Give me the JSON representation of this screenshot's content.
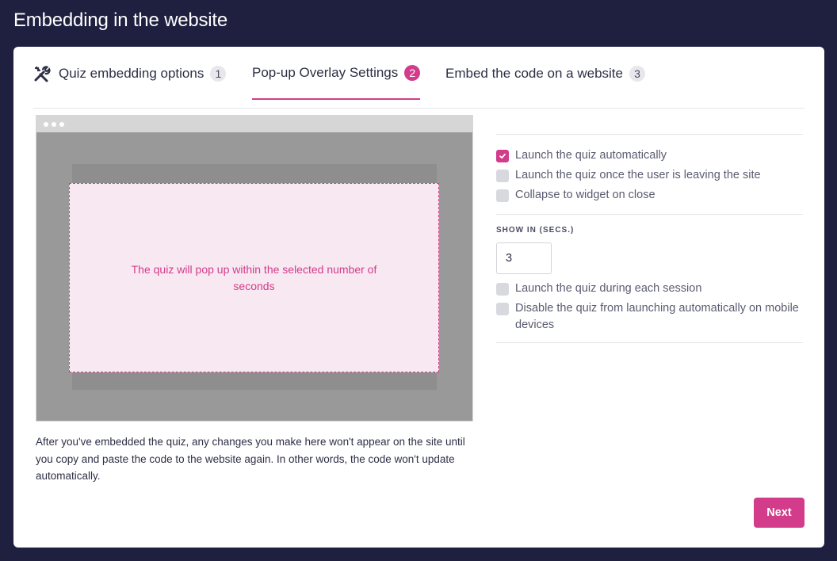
{
  "page": {
    "title": "Embedding in the website"
  },
  "tabs": [
    {
      "label": "Quiz embedding options",
      "number": "1",
      "icon": "tools-icon"
    },
    {
      "label": "Pop-up Overlay Settings",
      "number": "2",
      "active": true
    },
    {
      "label": "Embed the code on a website",
      "number": "3"
    }
  ],
  "preview": {
    "popup_text": "The quiz will pop up within the selected number of seconds"
  },
  "note": "After you've embedded the quiz, any changes you make here won't appear on the site until you copy and paste the code to the website again. In other words, the code won't update automatically.",
  "settings": {
    "options_top": [
      {
        "label": "Launch the quiz automatically",
        "checked": true
      },
      {
        "label": "Launch the quiz once the user is leaving the site",
        "checked": false
      },
      {
        "label": "Collapse to widget on close",
        "checked": false
      }
    ],
    "show_in_label": "SHOW IN (SECS.)",
    "show_in_value": "3",
    "options_bottom": [
      {
        "label": "Launch the quiz during each session",
        "checked": false
      },
      {
        "label": "Disable the quiz from launching automatically on mobile devices",
        "checked": false
      }
    ]
  },
  "actions": {
    "next_label": "Next"
  },
  "colors": {
    "accent": "#d23c8a",
    "background": "#1f2040",
    "popup_bg": "#f8e8f1"
  }
}
